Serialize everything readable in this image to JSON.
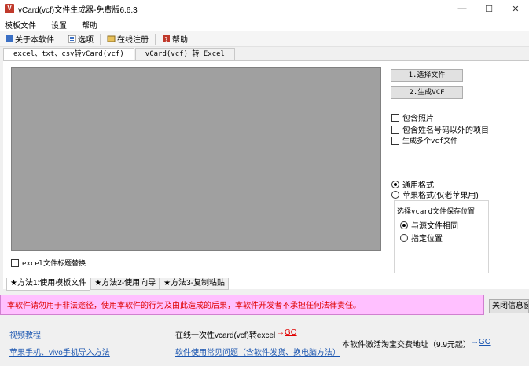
{
  "window": {
    "title": "vCard(vcf)文件生成器-免费版6.6.3",
    "icon_label": "V",
    "minimize_glyph": "—",
    "maximize_glyph": "☐",
    "close_glyph": "✕"
  },
  "menu": {
    "items": [
      "模板文件",
      "设置",
      "帮助"
    ]
  },
  "toolbar": {
    "about_label": "关于本软件",
    "options_label": "选项",
    "register_label": "在线注册",
    "help_label": "帮助"
  },
  "tabs_top": [
    "excel、txt、csv转vCard(vcf)",
    "vCard(vcf) 转 Excel"
  ],
  "buttons": {
    "select_file": "1.选择文件",
    "generate_vcf": "2.生成VCF"
  },
  "checkboxes": {
    "include_photo": "包含照片",
    "include_other": "包含姓名号码以外的项目",
    "multiple_vcf": "生成多个vcf文件",
    "excel_header_replace": "excel文件标题替换"
  },
  "format_radios": {
    "general": "通用格式",
    "apple": "苹果格式(仅老苹果用)"
  },
  "save_group": {
    "title": "选择vcard文件保存位置",
    "same_as_source": "与源文件相同",
    "specified": "指定位置"
  },
  "tabs_bottom": [
    "★方法1:使用模板文件",
    "★方法2-使用向导",
    "★方法3-复制粘贴"
  ],
  "warning": {
    "text": "本软件请勿用于非法途径，使用本软件的行为及由此造成的后果，本软件开发者不承担任何法律责任。",
    "close_button": "关闭信息窗"
  },
  "footer": {
    "video_tutorial": "视频教程",
    "phone_import": "苹果手机、vivo手机导入方法",
    "online_convert": "在线一次性vcard(vcf)转excel",
    "faq": "软件使用常见问题（含软件发货、换电脑方法）",
    "taobao": "本软件激活淘宝交费地址（9.9元起）",
    "go_arrow": "→",
    "go_label": "GO"
  },
  "colors": {
    "warning_bg": "#ffc0ff",
    "warning_text": "#e00000",
    "link": "#1a55b0",
    "preview_gray": "#a0a0a0"
  }
}
